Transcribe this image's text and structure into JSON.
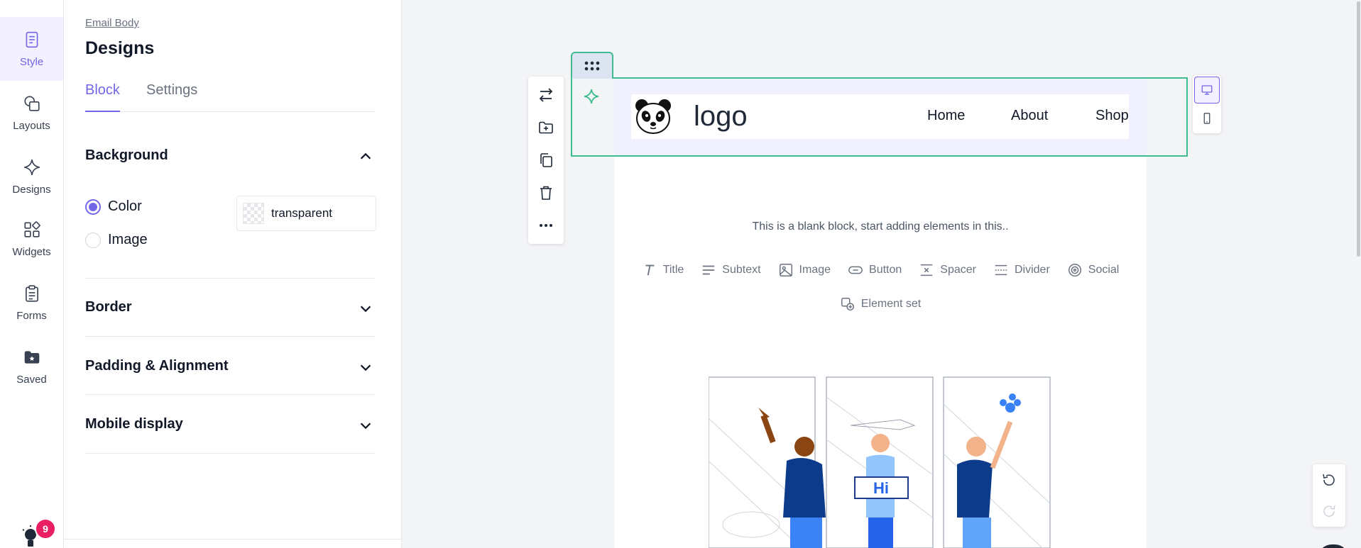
{
  "rail": {
    "items": [
      {
        "label": "Style",
        "icon": "style-page-icon",
        "active": true
      },
      {
        "label": "Layouts",
        "icon": "layouts-shapes-icon"
      },
      {
        "label": "Designs",
        "icon": "designs-sparkle-icon"
      },
      {
        "label": "Widgets",
        "icon": "widgets-grid-icon"
      },
      {
        "label": "Forms",
        "icon": "forms-clipboard-icon"
      },
      {
        "label": "Saved",
        "icon": "saved-folder-icon"
      }
    ],
    "notifications": "9"
  },
  "panel": {
    "breadcrumb": "Email Body",
    "title": "Designs",
    "tabs": [
      {
        "label": "Block",
        "active": true
      },
      {
        "label": "Settings"
      }
    ],
    "background": {
      "heading": "Background",
      "options": [
        {
          "label": "Color",
          "checked": true
        },
        {
          "label": "Image",
          "checked": false
        }
      ],
      "color_value": "transparent"
    },
    "sections": [
      "Border",
      "Padding & Alignment",
      "Mobile display"
    ]
  },
  "canvas": {
    "header": {
      "logo_text": "logo",
      "nav": [
        "Home",
        "About",
        "Shop"
      ]
    },
    "blank_message": "This is a blank block, start adding elements in this..",
    "elements": [
      "Title",
      "Subtext",
      "Image",
      "Button",
      "Spacer",
      "Divider",
      "Social"
    ],
    "element_set": "Element set",
    "illustration_sign": "Hi"
  },
  "colors": {
    "accent": "#7366e6",
    "selection": "#3dbb91",
    "badge": "#e91e63"
  }
}
